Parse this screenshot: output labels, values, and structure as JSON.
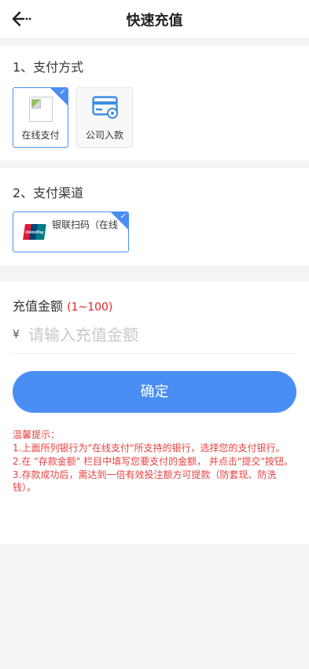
{
  "header": {
    "title": "快速充值",
    "back_icon": "arrow-left-icon"
  },
  "payment_method": {
    "title": "1、支付方式",
    "options": [
      {
        "label": "在线支付",
        "icon": "broken-image-icon",
        "selected": true
      },
      {
        "label": "公司入款",
        "icon": "card-gear-icon",
        "selected": false
      }
    ]
  },
  "payment_channel": {
    "title": "2、支付渠道",
    "options": [
      {
        "label": "银联扫码（在线",
        "icon": "unionpay-logo",
        "selected": true
      }
    ]
  },
  "amount": {
    "title": "充值金额",
    "range": "(1~100)",
    "currency": "¥",
    "placeholder": "请输入充值金额",
    "value": ""
  },
  "confirm_label": "确定",
  "tips": {
    "heading": "温馨提示：",
    "lines": [
      "1.上面所列银行为\"在线支付\"所支持的银行，选择您的支付银行。",
      "2.在 \"存款金额\" 栏目中填写您要支付的金额，  并点击\"提交\"按钮。",
      "3.存款成功后，需达到一倍有效投注额方可提款（防套现、防洗钱）。"
    ]
  },
  "colors": {
    "accent": "#4a8ef3",
    "tip_text": "#e94040",
    "range_text": "#e41f1f"
  }
}
